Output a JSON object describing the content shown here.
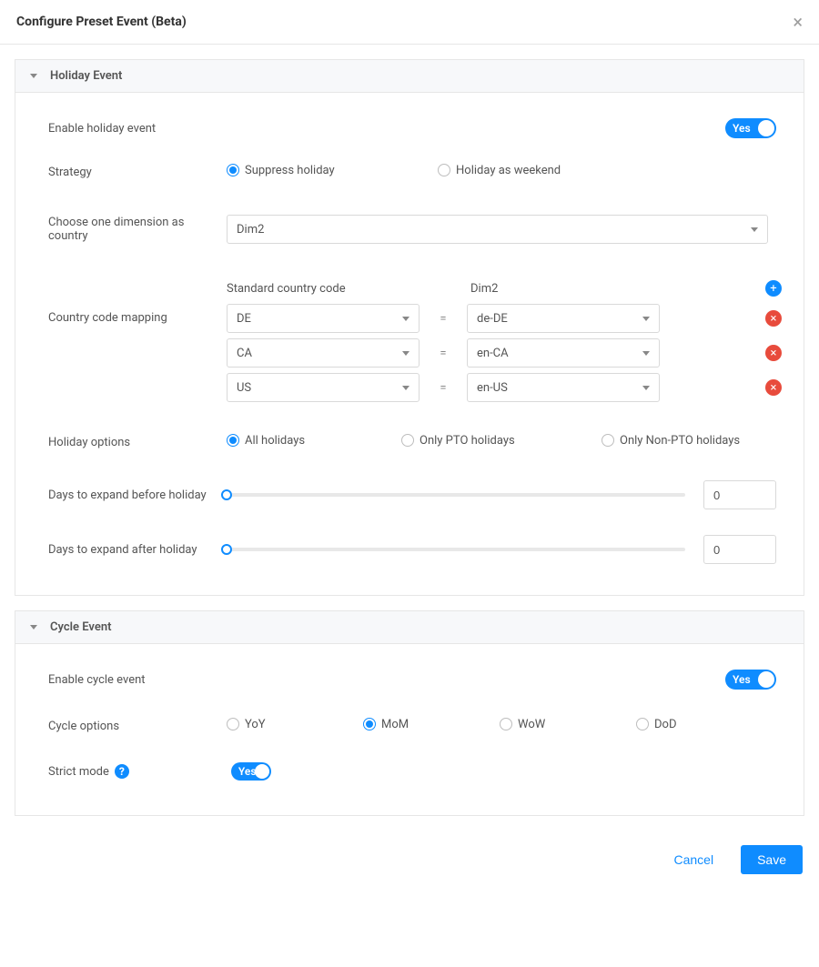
{
  "header": {
    "title": "Configure Preset Event (Beta)"
  },
  "toggle_yes": "Yes",
  "holiday": {
    "section_title": "Holiday Event",
    "enable_label": "Enable holiday event",
    "enable_on": true,
    "strategy_label": "Strategy",
    "strategy_opts": {
      "suppress": "Suppress holiday",
      "weekend": "Holiday as weekend"
    },
    "strategy_selected": "suppress",
    "dimension_label": "Choose one dimension as country",
    "dimension_value": "Dim2",
    "mapping_label": "Country code mapping",
    "mapping_cols": {
      "left": "Standard country code",
      "right": "Dim2"
    },
    "mapping_rows": [
      {
        "code": "DE",
        "value": "de-DE"
      },
      {
        "code": "CA",
        "value": "en-CA"
      },
      {
        "code": "US",
        "value": "en-US"
      }
    ],
    "options_label": "Holiday options",
    "options": {
      "all": "All holidays",
      "pto": "Only PTO holidays",
      "nonpto": "Only Non-PTO holidays"
    },
    "options_selected": "all",
    "before_label": "Days to expand before holiday",
    "before_value": "0",
    "after_label": "Days to expand after holiday",
    "after_value": "0"
  },
  "cycle": {
    "section_title": "Cycle Event",
    "enable_label": "Enable cycle event",
    "enable_on": true,
    "options_label": "Cycle options",
    "options": {
      "yoy": "YoY",
      "mom": "MoM",
      "wow": "WoW",
      "dod": "DoD"
    },
    "options_selected": "mom",
    "strict_label": "Strict mode",
    "strict_on": true
  },
  "footer": {
    "cancel": "Cancel",
    "save": "Save"
  }
}
